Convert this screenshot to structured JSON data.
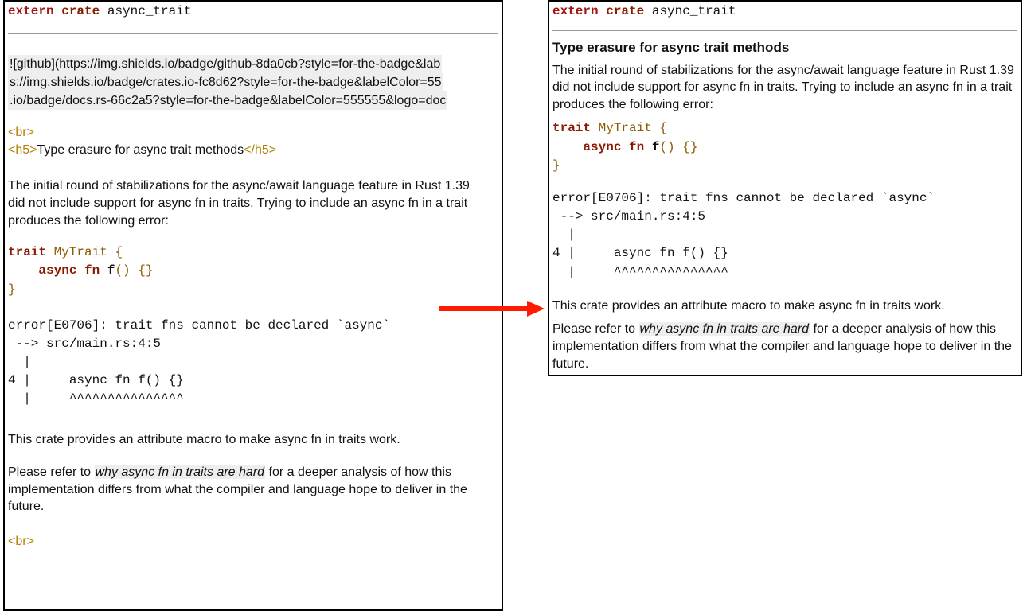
{
  "head_line": {
    "kw1": "extern",
    "kw2": "crate",
    "ident": "async_trait"
  },
  "badges": {
    "line1": "![github](https://img.shields.io/badge/github-8da0cb?style=for-the-badge&lab",
    "line2": "s://img.shields.io/badge/crates.io-fc8d62?style=for-the-badge&labelColor=55",
    "line3": ".io/badge/docs.rs-66c2a5?style=for-the-badge&labelColor=555555&logo=doc"
  },
  "tags": {
    "br_open": "<br>",
    "h5_open": "<h5>",
    "h5_close": "</h5>"
  },
  "title": "Type erasure for async trait methods",
  "para1": "The initial round of stabilizations for the async/await language feature in Rust 1.39 did not include support for async fn in traits. Trying to include an async fn in a trait produces the following error:",
  "code_trait": {
    "l1_kw": "trait",
    "l1_ty": "MyTrait",
    "l1_brace": "{",
    "l2_indent": "    ",
    "l2_kw": "async",
    "l2_fn_kw": "fn",
    "l2_fn": "f",
    "l2_rest": "() {}",
    "l3": "}"
  },
  "error_block": "error[E0706]: trait fns cannot be declared `async`\n --> src/main.rs:4:5\n  |\n4 |     async fn f() {}\n  |     ^^^^^^^^^^^^^^^",
  "para2": "This crate provides an attribute macro to make async fn in traits work.",
  "para3_a": "Please refer to ",
  "para3_link": "why async fn in traits are hard",
  "para3_b": " for a deeper analysis of how this implementation differs from what the compiler and language hope to deliver in the future."
}
